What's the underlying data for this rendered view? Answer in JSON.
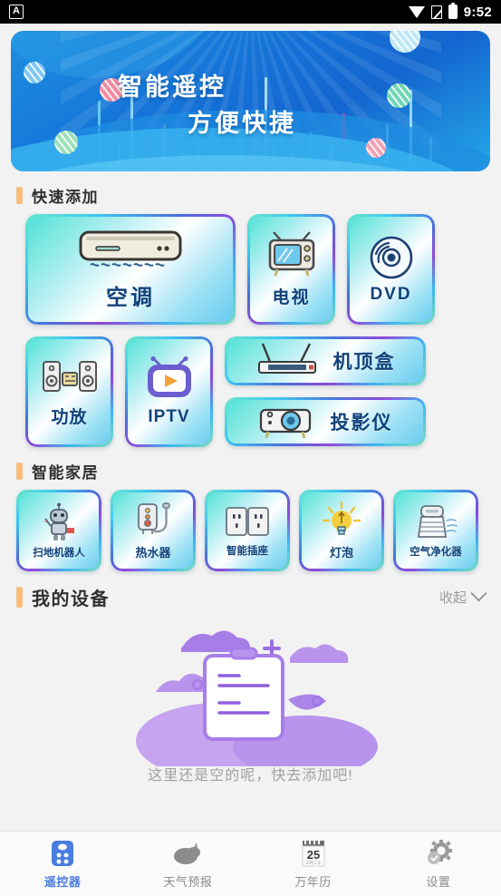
{
  "statusbar": {
    "left_icon": "app-badge-a-icon",
    "badge_letter": "A",
    "icons": [
      "wifi-icon",
      "signal-off-icon",
      "battery-icon"
    ],
    "time": "9:52"
  },
  "banner": {
    "title_line1": "智能遥控",
    "title_line2": "方便快捷",
    "bg_color": "#1574d8",
    "accent_color": "#39b4ef"
  },
  "sections": {
    "quick_add": {
      "title": "快速添加",
      "accent_color": "#f7bc7c"
    },
    "smart_home": {
      "title": "智能家居",
      "accent_color": "#f7bc7c"
    },
    "my_devices": {
      "title": "我的设备",
      "collapse_label": "收起",
      "collapse_icon": "chevron-down-icon",
      "accent_color": "#f7bc7c"
    }
  },
  "quick_add_cards": [
    {
      "label": "空调",
      "icon": "air-conditioner-icon"
    },
    {
      "label": "电视",
      "icon": "television-icon"
    },
    {
      "label": "DVD",
      "icon": "dvd-disc-icon"
    },
    {
      "label": "功放",
      "icon": "amplifier-icon"
    },
    {
      "label": "IPTV",
      "icon": "iptv-play-icon"
    },
    {
      "label": "机顶盒",
      "icon": "set-top-box-icon"
    },
    {
      "label": "投影仪",
      "icon": "projector-icon"
    }
  ],
  "smart_home_cards": [
    {
      "label": "扫地机器人",
      "icon": "robot-vacuum-icon"
    },
    {
      "label": "热水器",
      "icon": "water-heater-icon"
    },
    {
      "label": "智能插座",
      "icon": "smart-socket-icon"
    },
    {
      "label": "灯泡",
      "icon": "light-bulb-icon"
    },
    {
      "label": "空气净化器",
      "icon": "air-purifier-icon"
    }
  ],
  "empty_state": {
    "message": "这里还是空的呢，快去添加吧!",
    "illustration": "empty-clipboard-illustration",
    "color": "#a77ee8"
  },
  "bottom_nav": {
    "active_color": "#4a7de0",
    "items": [
      {
        "label": "遥控器",
        "icon": "remote-control-icon",
        "active": true
      },
      {
        "label": "天气预报",
        "icon": "cloud-weather-icon",
        "active": false
      },
      {
        "label": "万年历",
        "icon": "calendar-icon",
        "active": false,
        "day": "25",
        "sub": "三月二十"
      },
      {
        "label": "设置",
        "icon": "gear-icon",
        "active": false
      }
    ]
  }
}
